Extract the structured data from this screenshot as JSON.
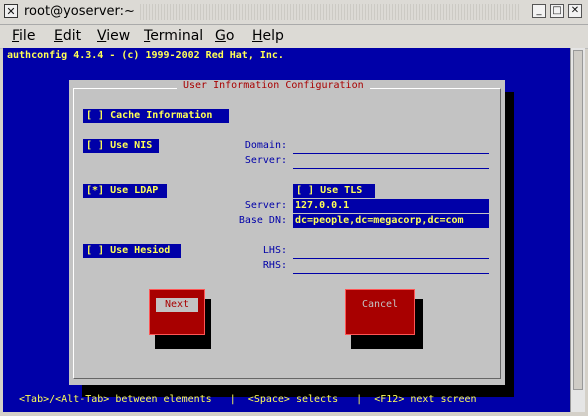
{
  "window": {
    "icon": "✕",
    "title": "root@yoserver:~",
    "controls": {
      "iconify": "_",
      "maximize": "□",
      "close": "✕"
    }
  },
  "menubar": {
    "file": {
      "accel": "F",
      "rest": "ile"
    },
    "edit": {
      "accel": "E",
      "rest": "dit"
    },
    "view": {
      "accel": "V",
      "rest": "iew"
    },
    "terminal": {
      "accel": "T",
      "rest": "erminal"
    },
    "go": {
      "accel": "G",
      "rest": "o"
    },
    "help": {
      "accel": "H",
      "rest": "elp"
    }
  },
  "terminal": {
    "header": "authconfig 4.3.4 - (c) 1999-2002 Red Hat, Inc.",
    "statusline": " <Tab>/<Alt-Tab> between elements   |  <Space> selects   |  <F12> next screen"
  },
  "dialog": {
    "title": "User Information Configuration",
    "cache": {
      "box": "[ ]",
      "label": "Cache Information"
    },
    "nis": {
      "box": "[ ]",
      "label": "Use NIS",
      "domain_label": "Domain:",
      "domain_value": "",
      "server_label": "Server:",
      "server_value": ""
    },
    "ldap": {
      "box": "[*]",
      "label": "Use LDAP",
      "tls_box": "[ ]",
      "tls_label": "Use TLS",
      "server_label": "Server:",
      "server_value": "127.0.0.1",
      "basedn_label": "Base DN:",
      "basedn_value": "dc=people,dc=megacorp,dc=com"
    },
    "hesiod": {
      "box": "[ ]",
      "label": "Use Hesiod",
      "lhs_label": "LHS:",
      "lhs_value": "",
      "rhs_label": "RHS:",
      "rhs_value": ""
    },
    "buttons": {
      "next": "Next",
      "cancel": "Cancel"
    }
  }
}
